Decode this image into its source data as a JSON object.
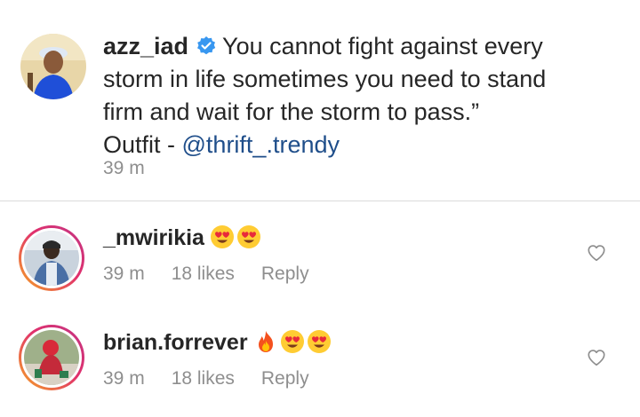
{
  "caption": {
    "username": "azz_iad",
    "text_line1": "You cannot fight against every",
    "text_line2": "storm in life sometimes you need to stand",
    "text_line3": "firm and wait for the storm to pass.”",
    "outfit_prefix": "Outfit - ",
    "mention": "@thrift_.trendy",
    "time": "39 m"
  },
  "comments": [
    {
      "username": "_mwirikia",
      "emojis": [
        "heart-eyes",
        "heart-eyes"
      ],
      "time": "39 m",
      "likes": "18 likes",
      "reply_label": "Reply"
    },
    {
      "username": "brian.forrever",
      "emojis": [
        "fire",
        "heart-eyes",
        "heart-eyes"
      ],
      "time": "39 m",
      "likes": "18 likes",
      "reply_label": "Reply"
    }
  ],
  "colors": {
    "text": "#262626",
    "meta": "#8e8e8e",
    "mention": "#1f4e8a",
    "verified": "#3897f0",
    "divider": "#dbdbdb"
  }
}
